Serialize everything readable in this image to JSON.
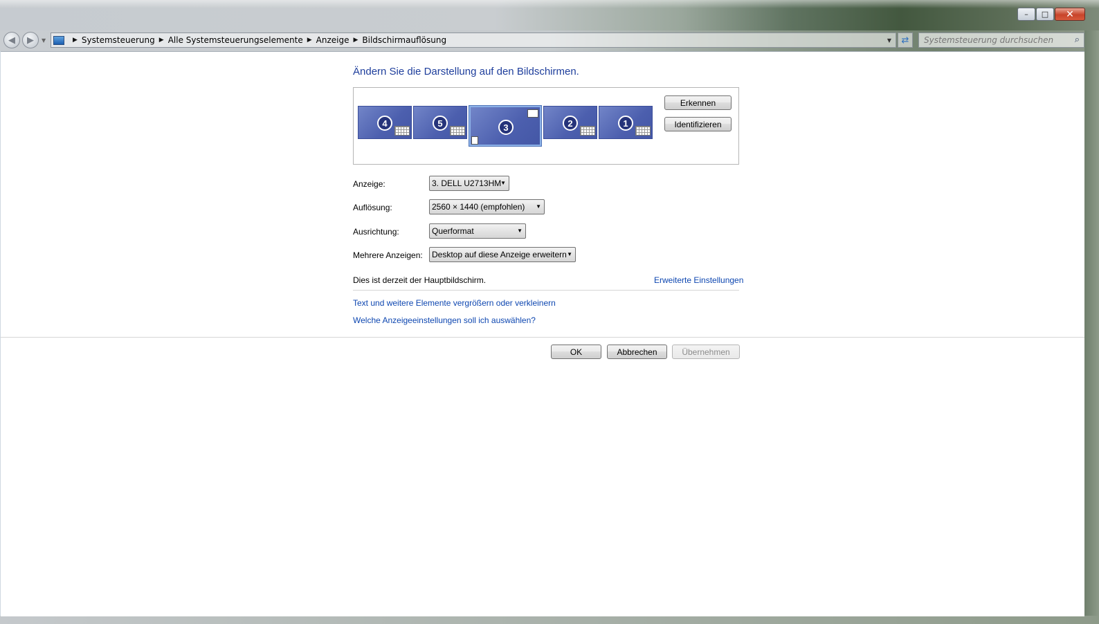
{
  "window": {
    "minimize_glyph": "–",
    "maximize_glyph": "□",
    "close_glyph": "✕"
  },
  "nav": {
    "back_glyph": "◀",
    "forward_glyph": "▶",
    "breadcrumbs": [
      "Systemsteuerung",
      "Alle Systemsteuerungselemente",
      "Anzeige",
      "Bildschirmauflösung"
    ],
    "search_placeholder": "Systemsteuerung durchsuchen",
    "search_icon": "⌕",
    "refresh_glyph": "⇄"
  },
  "page": {
    "heading": "Ändern Sie die Darstellung auf den Bildschirmen.",
    "monitors": [
      "4",
      "5",
      "3",
      "2",
      "1"
    ],
    "selected_monitor": "3",
    "detect_button": "Erkennen",
    "identify_button": "Identifizieren",
    "display_label": "Anzeige:",
    "display_value": "3. DELL U2713HM",
    "resolution_label": "Auflösung:",
    "resolution_value": "2560 × 1440 (empfohlen)",
    "orientation_label": "Ausrichtung:",
    "orientation_value": "Querformat",
    "multiple_label": "Mehrere Anzeigen:",
    "multiple_value": "Desktop auf diese Anzeige erweitern",
    "main_display_info": "Dies ist derzeit der Hauptbildschirm.",
    "advanced_link": "Erweiterte Einstellungen",
    "text_size_link": "Text und weitere Elemente vergrößern oder verkleinern",
    "which_settings_link": "Welche Anzeigeeinstellungen soll ich auswählen?",
    "ok_button": "OK",
    "cancel_button": "Abbrechen",
    "apply_button": "Übernehmen"
  },
  "colors": {
    "heading": "#1e3e9c",
    "link": "#0d46b0",
    "monitor_fill": "#5567b4"
  }
}
